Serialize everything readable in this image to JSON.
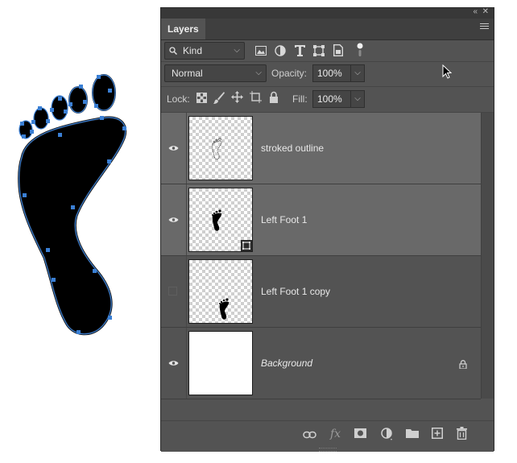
{
  "panel": {
    "collapse_label": "«",
    "close_label": "✕",
    "tab_label": "Layers",
    "menu_icon": "hamburger-menu-icon"
  },
  "filter": {
    "search_icon": "search-icon",
    "kind_label": "Kind",
    "filter_icons": [
      "image-filter-icon",
      "adjustment-filter-icon",
      "type-filter-icon",
      "shape-filter-icon",
      "smart-object-filter-icon",
      "filter-toggle-icon"
    ]
  },
  "blend": {
    "mode": "Normal",
    "opacity_label": "Opacity:",
    "opacity_value": "100%"
  },
  "lock": {
    "label": "Lock:",
    "icons": [
      "lock-transparent-pixels-icon",
      "lock-image-pixels-icon",
      "lock-position-icon",
      "lock-artboard-icon",
      "lock-all-icon"
    ],
    "fill_label": "Fill:",
    "fill_value": "100%"
  },
  "layers": [
    {
      "name": "stroked outline",
      "visible": true,
      "selected": true,
      "thumbnail": "small-foot-outline",
      "badge": ""
    },
    {
      "name": "Left Foot 1",
      "visible": true,
      "selected": true,
      "thumbnail": "small-foot-filled",
      "badge": "smart-object-badge-icon"
    },
    {
      "name": "Left Foot 1 copy",
      "visible": false,
      "selected": false,
      "thumbnail": "small-foot-filled-lower",
      "badge": ""
    },
    {
      "name": "Background",
      "visible": true,
      "selected": false,
      "thumbnail": "white",
      "badge": "lock-icon",
      "locked": true
    }
  ],
  "footer_icons": [
    "link-layers-icon",
    "fx-icon",
    "add-mask-icon",
    "adjustment-layer-icon",
    "new-group-icon",
    "new-layer-icon",
    "trash-icon"
  ],
  "colors": {
    "panel_bg": "#535353",
    "selected_row": "#696969",
    "path_blue": "#3a7fd4"
  }
}
